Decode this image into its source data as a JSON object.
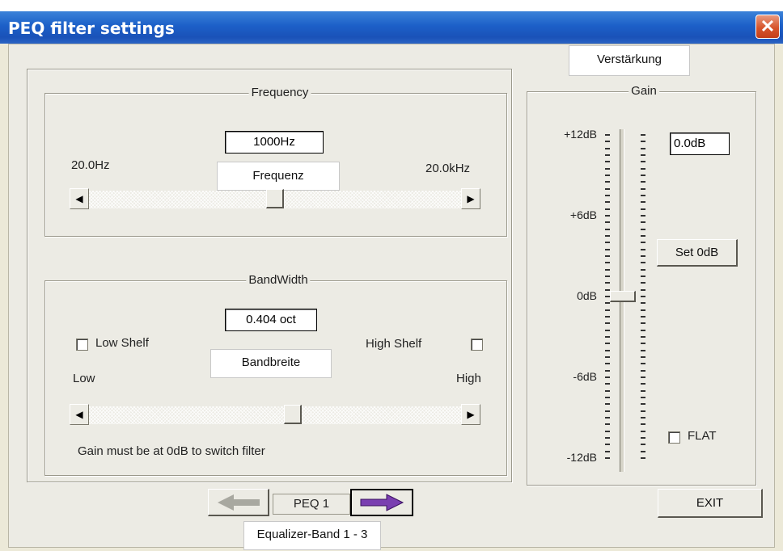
{
  "window": {
    "title": "PEQ filter settings"
  },
  "frequency": {
    "legend": "Frequency",
    "value": "1000Hz",
    "min_label": "20.0Hz",
    "max_label": "20.0kHz",
    "note": "Frequenz",
    "slider_level": 0.5
  },
  "bandwidth": {
    "legend": "BandWidth",
    "value": "0.404 oct",
    "low_shelf_label": "Low Shelf",
    "high_shelf_label": "High Shelf",
    "low_shelf_checked": false,
    "high_shelf_checked": false,
    "note": "Bandbreite",
    "low_label": "Low",
    "high_label": "High",
    "slider_level": 0.55,
    "footer_text": "Gain must be at 0dB to switch filter"
  },
  "gain": {
    "legend": "Gain",
    "note": "Verstärkung",
    "value": "0.0dB",
    "set_0db_label": "Set 0dB",
    "flat_label": "FLAT",
    "flat_checked": false,
    "scale": [
      "+12dB",
      "+6dB",
      "0dB",
      "-6dB",
      "-12dB"
    ],
    "level_db": 0
  },
  "nav": {
    "current_band": "PEQ 1",
    "note": "Equalizer-Band 1 - 3",
    "prev_icon": "arrow-left-icon",
    "next_icon": "arrow-right-icon"
  },
  "exit_label": "EXIT",
  "colors": {
    "titlebar": "#1c5fc8",
    "next_arrow": "#7a3fb0",
    "prev_arrow_disabled": "#a8a8a0",
    "close_button": "#d7552c"
  }
}
